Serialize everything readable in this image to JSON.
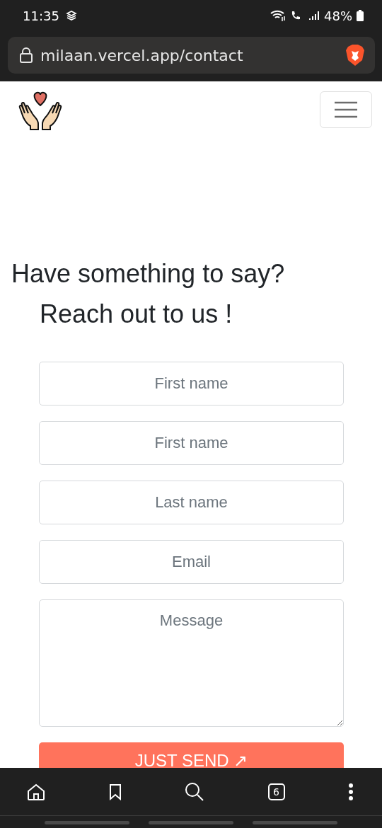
{
  "status_bar": {
    "time": "11:35",
    "battery": "48%"
  },
  "browser": {
    "url": "milaan.vercel.app/contact",
    "tab_count": "6"
  },
  "heading": {
    "line_1": "Have something to say?",
    "line_2": "Reach out to us !"
  },
  "form": {
    "fields": [
      {
        "kind": "input",
        "placeholder": "First name"
      },
      {
        "kind": "input",
        "placeholder": "First name"
      },
      {
        "kind": "input",
        "placeholder": "Last name"
      },
      {
        "kind": "input",
        "placeholder": "Email"
      },
      {
        "kind": "textarea",
        "placeholder": "Message"
      }
    ],
    "submit": "JUST SEND ↗"
  }
}
